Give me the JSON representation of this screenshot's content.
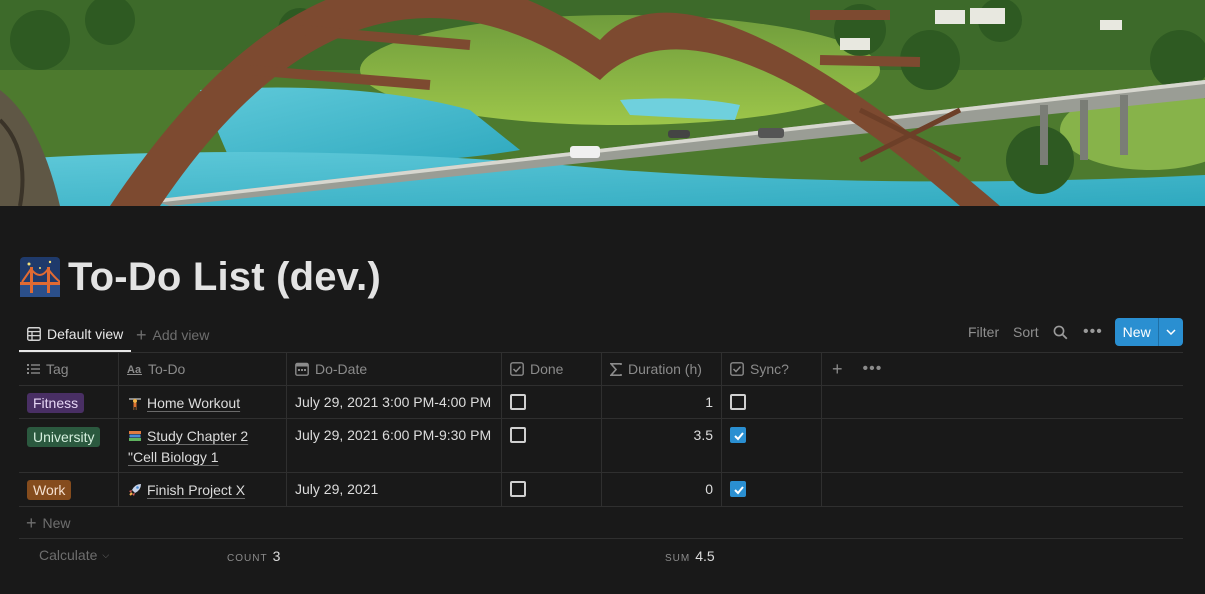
{
  "page": {
    "title": "To-Do List (dev.)",
    "icon": "bridge-at-night-emoji"
  },
  "views": {
    "default_label": "Default view",
    "add_label": "Add view"
  },
  "toolbar": {
    "filter_label": "Filter",
    "sort_label": "Sort",
    "search_icon": "search-icon",
    "more_icon": "more-horizontal-icon",
    "new_label": "New",
    "accent": "#2a8fd1"
  },
  "table": {
    "columns": [
      {
        "label": "Tag",
        "icon": "list-icon"
      },
      {
        "label": "To-Do",
        "icon": "text-aa-icon"
      },
      {
        "label": "Do-Date",
        "icon": "calendar-icon"
      },
      {
        "label": "Done",
        "icon": "checkbox-icon"
      },
      {
        "label": "Duration (h)",
        "icon": "sigma-icon"
      },
      {
        "label": "Sync?",
        "icon": "checkbox-icon"
      }
    ],
    "rows": [
      {
        "tag": "Fitness",
        "tag_color": "#492f64",
        "todo": "Home Workout",
        "todo_icon": "weightlifter-emoji",
        "date": "July 29, 2021 3:00 PM-4:00 PM",
        "done": false,
        "duration": "1",
        "sync": false
      },
      {
        "tag": "University",
        "tag_color": "#2b593f",
        "todo": "Study Chapter 2 \"Cell Biology 1",
        "todo_icon": "books-emoji",
        "date": "July 29, 2021 6:00 PM-9:30 PM",
        "done": false,
        "duration": "3.5",
        "sync": true
      },
      {
        "tag": "Work",
        "tag_color": "#854c1d",
        "todo": "Finish Project X",
        "todo_icon": "rocket-emoji",
        "date": "July 29, 2021",
        "done": false,
        "duration": "0",
        "sync": true
      }
    ],
    "new_row_label": "New"
  },
  "footer": {
    "calculate_label": "Calculate",
    "count_key": "COUNT",
    "count_value": "3",
    "sum_key": "SUM",
    "sum_value": "4.5"
  }
}
